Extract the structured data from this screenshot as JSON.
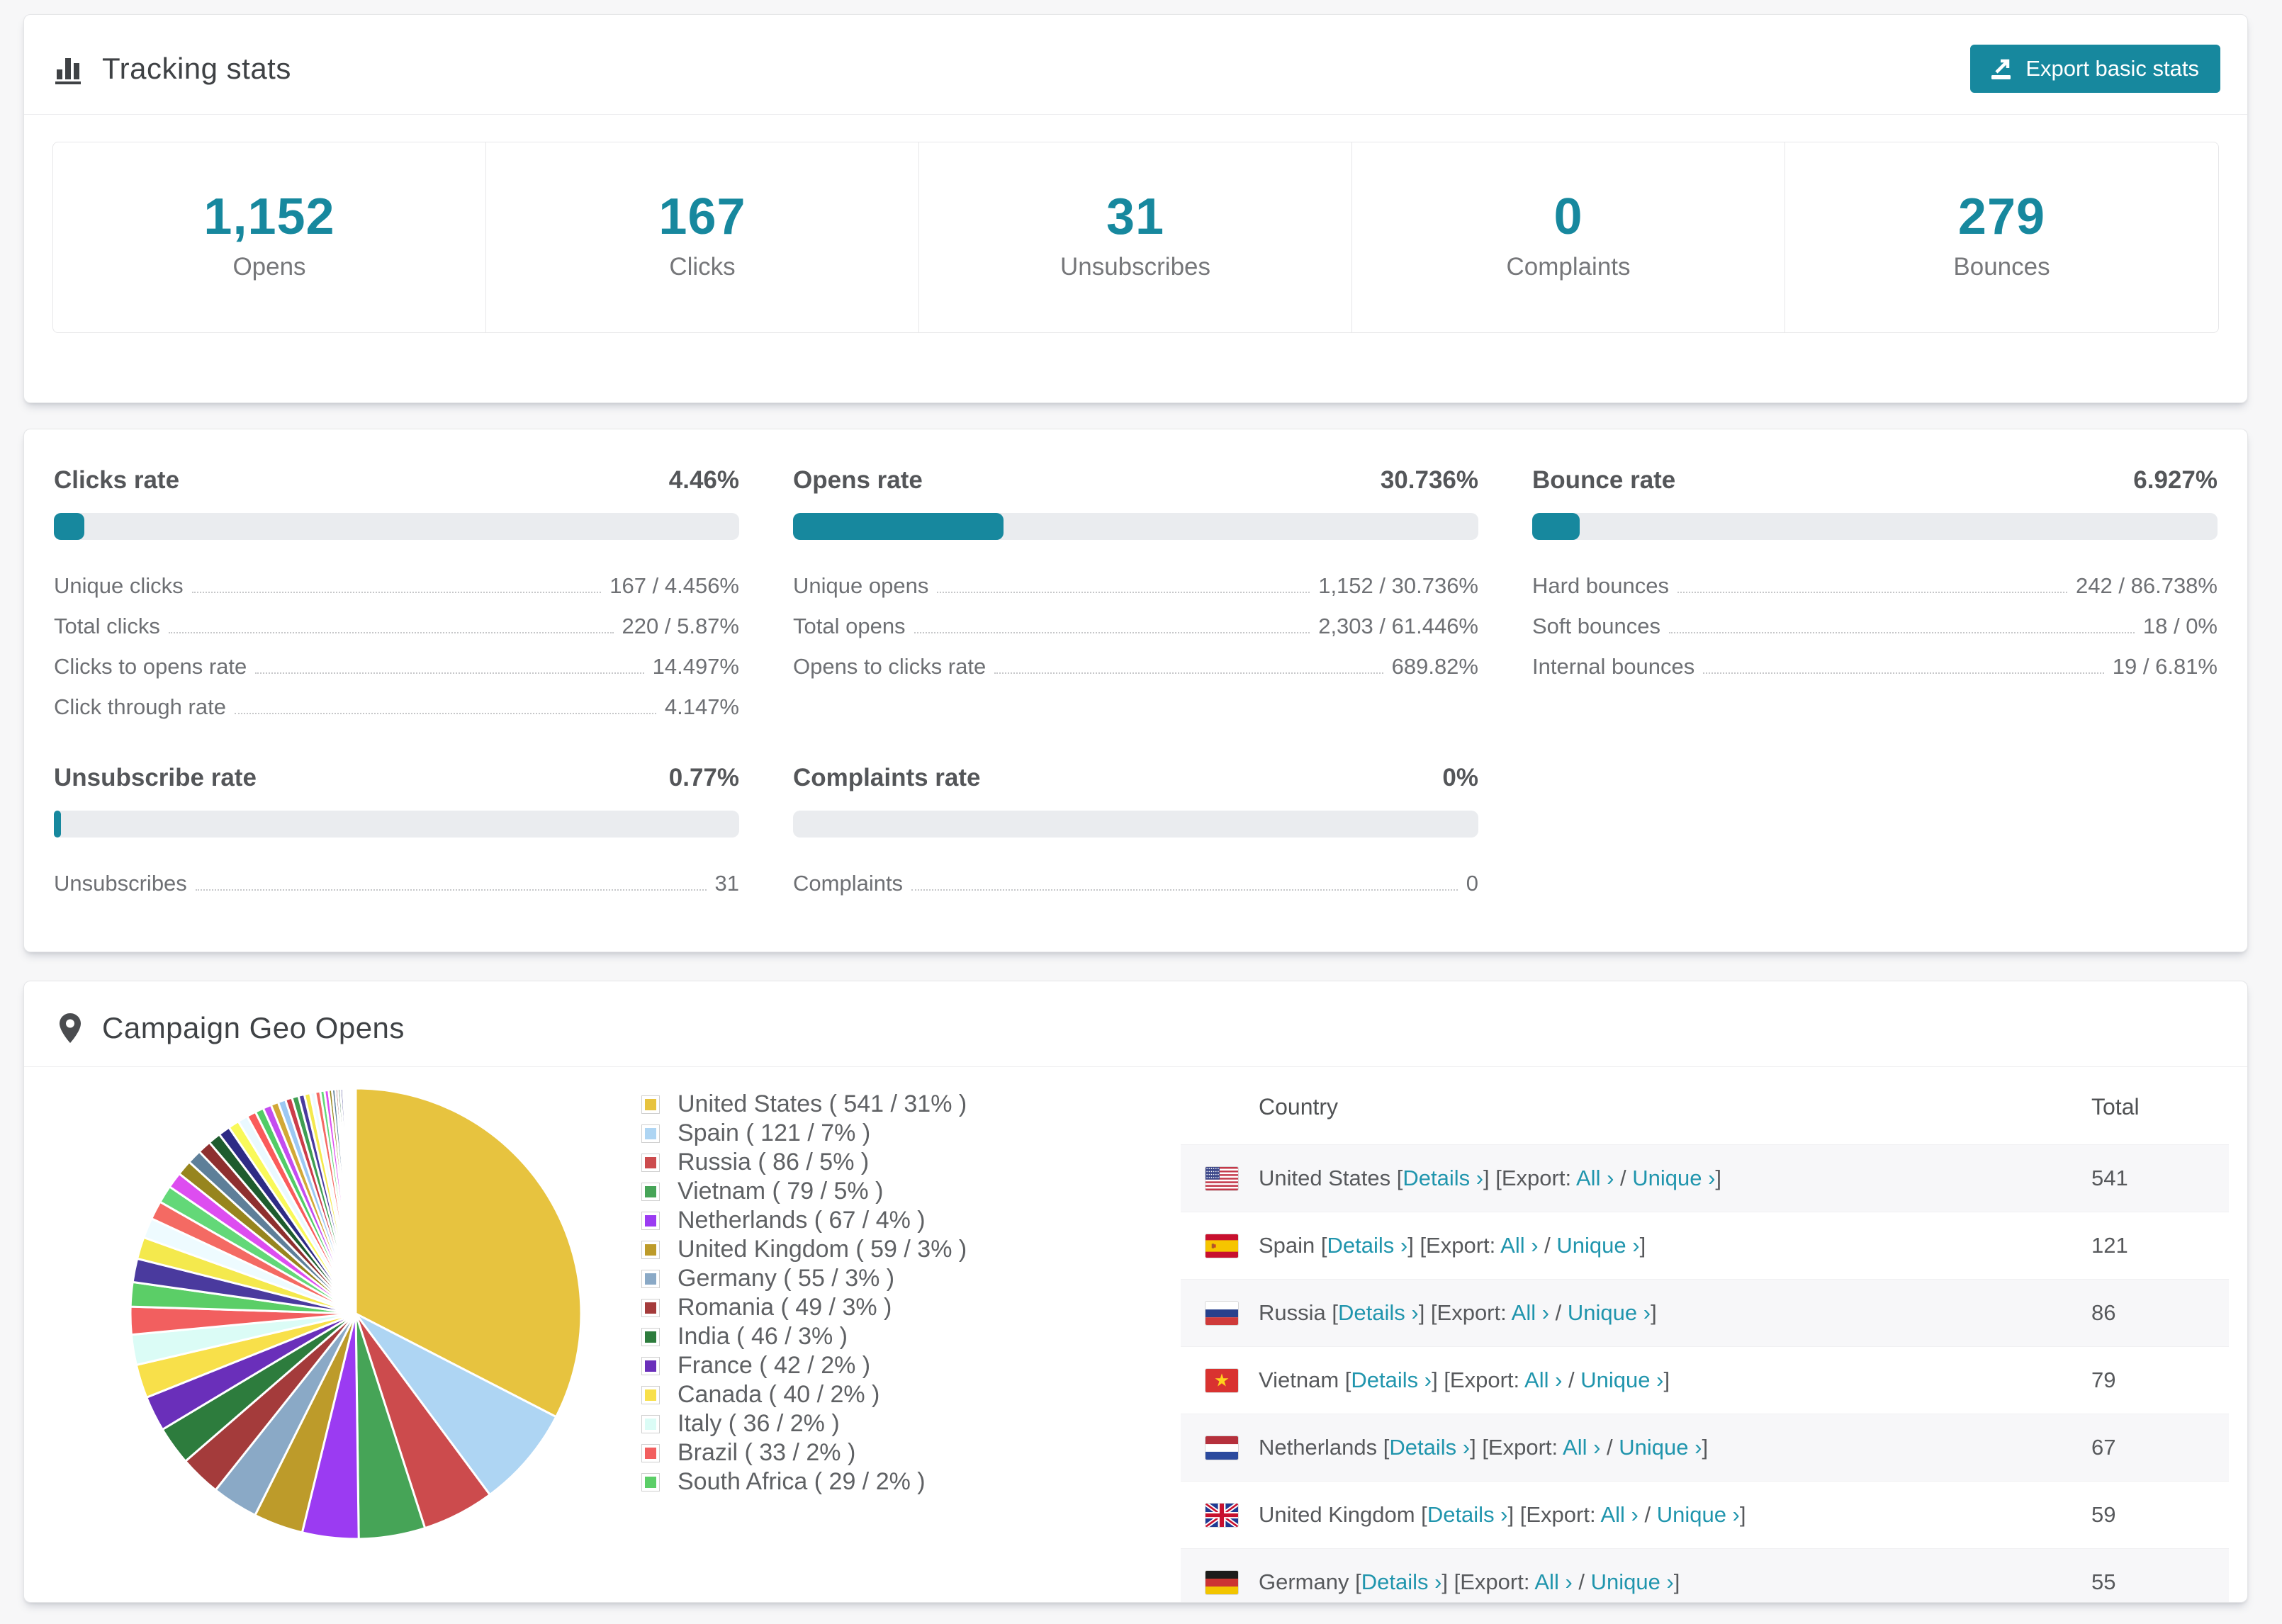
{
  "colors": {
    "accent": "#17889e",
    "link": "#2095ad",
    "bar_track": "#eaecef"
  },
  "tracking": {
    "title": "Tracking stats",
    "export_label": "Export basic stats",
    "stats": [
      {
        "value": "1,152",
        "label": "Opens"
      },
      {
        "value": "167",
        "label": "Clicks"
      },
      {
        "value": "31",
        "label": "Unsubscribes"
      },
      {
        "value": "0",
        "label": "Complaints"
      },
      {
        "value": "279",
        "label": "Bounces"
      }
    ]
  },
  "rates": [
    {
      "title": "Clicks rate",
      "value": "4.46%",
      "percent": 4.46,
      "rows": [
        {
          "label": "Unique clicks",
          "value": "167 / 4.456%"
        },
        {
          "label": "Total clicks",
          "value": "220 / 5.87%"
        },
        {
          "label": "Clicks to opens rate",
          "value": "14.497%"
        },
        {
          "label": "Click through rate",
          "value": "4.147%"
        }
      ]
    },
    {
      "title": "Opens rate",
      "value": "30.736%",
      "percent": 30.736,
      "rows": [
        {
          "label": "Unique opens",
          "value": "1,152 / 30.736%"
        },
        {
          "label": "Total opens",
          "value": "2,303 / 61.446%"
        },
        {
          "label": "Opens to clicks rate",
          "value": "689.82%"
        }
      ]
    },
    {
      "title": "Bounce rate",
      "value": "6.927%",
      "percent": 6.927,
      "rows": [
        {
          "label": "Hard bounces",
          "value": "242 / 86.738%"
        },
        {
          "label": "Soft bounces",
          "value": "18 / 0%"
        },
        {
          "label": "Internal bounces",
          "value": "19 / 6.81%"
        }
      ]
    },
    {
      "title": "Unsubscribe rate",
      "value": "0.77%",
      "percent": 0.77,
      "rows": [
        {
          "label": "Unsubscribes",
          "value": "31"
        }
      ]
    },
    {
      "title": "Complaints rate",
      "value": "0%",
      "percent": 0,
      "rows": [
        {
          "label": "Complaints",
          "value": "0"
        }
      ]
    }
  ],
  "geo": {
    "title": "Campaign Geo Opens",
    "chart_data": {
      "type": "pie",
      "title": "Campaign Geo Opens",
      "legend_position": "right",
      "start_angle_deg": -90,
      "direction": "clockwise",
      "entries": [
        {
          "name": "United States",
          "value": 541,
          "pct": 31,
          "color": "#e7c33f",
          "flag": "us"
        },
        {
          "name": "Spain",
          "value": 121,
          "pct": 7,
          "color": "#aed5f3",
          "flag": "es"
        },
        {
          "name": "Russia",
          "value": 86,
          "pct": 5,
          "color": "#cc4b4d",
          "flag": "ru"
        },
        {
          "name": "Vietnam",
          "value": 79,
          "pct": 5,
          "color": "#46a457",
          "flag": "vn"
        },
        {
          "name": "Netherlands",
          "value": 67,
          "pct": 4,
          "color": "#9b3bf2",
          "flag": "nl"
        },
        {
          "name": "United Kingdom",
          "value": 59,
          "pct": 3,
          "color": "#bd9b2a",
          "flag": "gb"
        },
        {
          "name": "Germany",
          "value": 55,
          "pct": 3,
          "color": "#8aa9c6",
          "flag": "de"
        },
        {
          "name": "Romania",
          "value": 49,
          "pct": 3,
          "color": "#a43b3b",
          "flag": "ro"
        },
        {
          "name": "India",
          "value": 46,
          "pct": 3,
          "color": "#2d7c3d",
          "flag": "in"
        },
        {
          "name": "France",
          "value": 42,
          "pct": 2,
          "color": "#6a2fba",
          "flag": "fr"
        },
        {
          "name": "Canada",
          "value": 40,
          "pct": 2,
          "color": "#f8e04a",
          "flag": "ca"
        },
        {
          "name": "Italy",
          "value": 36,
          "pct": 2,
          "color": "#dbfcf6",
          "flag": "it"
        },
        {
          "name": "Brazil",
          "value": 33,
          "pct": 2,
          "color": "#f25f5f",
          "flag": "br"
        },
        {
          "name": "South Africa",
          "value": 29,
          "pct": 2,
          "color": "#5bce67",
          "flag": "za"
        }
      ],
      "others_values": [
        28,
        26,
        24,
        22,
        21,
        19,
        18,
        17,
        16,
        15,
        14,
        13,
        12,
        11,
        10,
        10,
        9,
        9,
        8,
        8,
        7,
        7,
        6,
        6,
        5,
        5,
        4,
        4,
        3,
        3,
        3,
        2,
        2,
        2,
        2,
        1,
        1,
        1,
        1,
        1,
        1,
        1
      ],
      "others_palette": [
        "#4a3a9e",
        "#f4e94d",
        "#eefbff",
        "#f46a63",
        "#63d878",
        "#dd4df0",
        "#97851e",
        "#5e7f99",
        "#8e2f2f",
        "#1e5c2e",
        "#2e2b85",
        "#f9f95a",
        "#eaf9ff",
        "#fa5b5b",
        "#52cc66",
        "#c44df0",
        "#d2a836",
        "#9cc8f2",
        "#cc3d4a",
        "#3f9e52"
      ]
    },
    "legend_format": "{name} ( {value} / {pct}% )",
    "table": {
      "columns": [
        "Country",
        "Total"
      ],
      "details_label": "Details",
      "export_prefix": "Export:",
      "all_label": "All",
      "unique_label": "Unique",
      "chevron": "›",
      "visible_rows": 7,
      "rows": [
        {
          "flag": "us",
          "name": "United States",
          "total": "541"
        },
        {
          "flag": "es",
          "name": "Spain",
          "total": "121"
        },
        {
          "flag": "ru",
          "name": "Russia",
          "total": "86"
        },
        {
          "flag": "vn",
          "name": "Vietnam",
          "total": "79"
        },
        {
          "flag": "nl",
          "name": "Netherlands",
          "total": "67"
        },
        {
          "flag": "gb",
          "name": "United Kingdom",
          "total": "59"
        },
        {
          "flag": "de",
          "name": "Germany",
          "total": "55",
          "partial": true
        }
      ]
    }
  }
}
